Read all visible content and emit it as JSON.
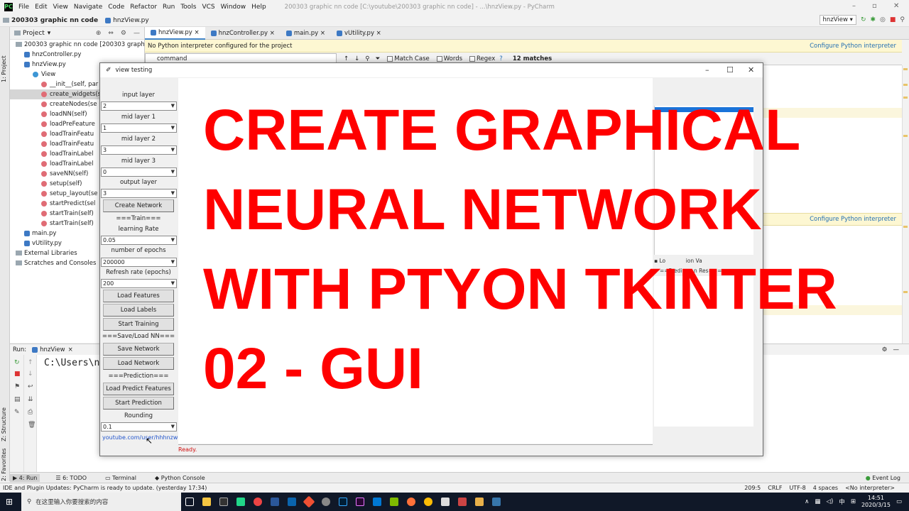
{
  "menubar": {
    "items": [
      "File",
      "Edit",
      "View",
      "Navigate",
      "Code",
      "Refactor",
      "Run",
      "Tools",
      "VCS",
      "Window",
      "Help"
    ],
    "window_title": "200303 graphic nn code [C:\\youtube\\200303 graphic nn code] - ...\\hnzView.py - PyCharm"
  },
  "navbar": {
    "project": "200303 graphic nn code",
    "file": "hnzView.py",
    "run_config": "hnzView"
  },
  "sidebar": {
    "project_tab": "1: Project",
    "structure_tab": "Z: Structure",
    "favorites_tab": "2: Favorites"
  },
  "project_panel": {
    "title": "Project",
    "tree": [
      {
        "label": "200303 graphic nn code [200303 graphi",
        "type": "folder",
        "indent": 1
      },
      {
        "label": "hnzController.py",
        "type": "py",
        "indent": 2
      },
      {
        "label": "hnzView.py",
        "type": "py",
        "indent": 2
      },
      {
        "label": "View",
        "type": "class",
        "indent": 3
      },
      {
        "label": "__init__(self, par",
        "type": "method",
        "indent": 4
      },
      {
        "label": "create_widgets(s",
        "type": "method",
        "indent": 4,
        "selected": true
      },
      {
        "label": "createNodes(se",
        "type": "method",
        "indent": 4
      },
      {
        "label": "loadNN(self)",
        "type": "method",
        "indent": 4
      },
      {
        "label": "loadPreFeature",
        "type": "method",
        "indent": 4
      },
      {
        "label": "loadTrainFeatu",
        "type": "method",
        "indent": 4
      },
      {
        "label": "loadTrainFeatu",
        "type": "method",
        "indent": 4
      },
      {
        "label": "loadTrainLabel",
        "type": "method",
        "indent": 4
      },
      {
        "label": "loadTrainLabel",
        "type": "method",
        "indent": 4
      },
      {
        "label": "saveNN(self)",
        "type": "method",
        "indent": 4
      },
      {
        "label": "setup(self)",
        "type": "method",
        "indent": 4
      },
      {
        "label": "setup_layout(se",
        "type": "method",
        "indent": 4
      },
      {
        "label": "startPredict(sel",
        "type": "method",
        "indent": 4
      },
      {
        "label": "startTrain(self)",
        "type": "method",
        "indent": 4
      },
      {
        "label": "startTrain(self)",
        "type": "method",
        "indent": 4
      },
      {
        "label": "main.py",
        "type": "py",
        "indent": 2
      },
      {
        "label": "vUtility.py",
        "type": "py",
        "indent": 2
      },
      {
        "label": "External Libraries",
        "type": "folder",
        "indent": 1
      },
      {
        "label": "Scratches and Consoles",
        "type": "folder",
        "indent": 1
      }
    ]
  },
  "editor": {
    "tabs": [
      {
        "label": "hnzView.py",
        "active": true
      },
      {
        "label": "hnzController.py",
        "active": false
      },
      {
        "label": "main.py",
        "active": false
      },
      {
        "label": "vUtility.py",
        "active": false
      }
    ],
    "warning": "No Python interpreter configured for the project",
    "warning_link": "Configure Python interpreter",
    "search_value": "command",
    "match_case": "Match Case",
    "words": "Words",
    "regex": "Regex",
    "regex_help": "?",
    "matches": "12 matches"
  },
  "run_panel": {
    "label": "Run:",
    "config": "hnzView",
    "console_text": "C:\\Users\\nz"
  },
  "bottom_tabs": {
    "run": "4: Run",
    "todo": "6: TODO",
    "terminal": "Terminal",
    "python_console": "Python Console",
    "event_log": "Event Log"
  },
  "status_bar": {
    "message": "IDE and Plugin Updates: PyCharm is ready to update. (yesterday 17:34)",
    "position": "209:5",
    "line_sep": "CRLF",
    "encoding": "UTF-8",
    "indent": "4 spaces",
    "interpreter": "<No interpreter>"
  },
  "taskbar": {
    "search_placeholder": "在这里输入你要搜索的内容",
    "ime": "中",
    "time": "14:51",
    "date": "2020/3/15"
  },
  "tk_window": {
    "title": "view testing",
    "fields": [
      {
        "label": "input layer",
        "value": "2"
      },
      {
        "label": "mid layer 1",
        "value": "1"
      },
      {
        "label": "mid layer 2",
        "value": "3"
      },
      {
        "label": "mid layer 3",
        "value": "0"
      },
      {
        "label": "output layer",
        "value": "3"
      }
    ],
    "create_network": "Create Network",
    "train_header": "===Train===",
    "learning_rate_label": "learning Rate",
    "learning_rate_value": "0.05",
    "epochs_label": "number of epochs",
    "epochs_value": "200000",
    "refresh_label": "Refresh rate (epochs)",
    "refresh_value": "200",
    "load_features": "Load Features",
    "load_labels": "Load Labels",
    "start_training": "Start Training",
    "saveload_header": "===Save/Load NN===",
    "save_network": "Save Network",
    "load_network": "Load Network",
    "prediction_header": "===Prediction===",
    "load_predict_features": "Load Predict Features",
    "start_prediction": "Start Prediction",
    "rounding_label": "Rounding",
    "rounding_value": "0.1",
    "link": "youtube.com/user/hhhnzw",
    "status": "Ready.",
    "list_label_1": "Lo",
    "list_label_2": "ion Va",
    "list_label_3": "==Predi",
    "list_label_4": "n Res",
    "list_label_5": "===="
  },
  "overlay": {
    "line1": "CREATE GRAPHICAL",
    "line2": "NEURAL NETWORK",
    "line3": "WITH PTYON TKINTER",
    "line4": "02 - GUI"
  },
  "colors": {
    "overlay_text": "#ff0000",
    "selection_blue": "#1a73d9",
    "warning_bg": "#fdf7d2",
    "link_blue": "#2470b3"
  }
}
